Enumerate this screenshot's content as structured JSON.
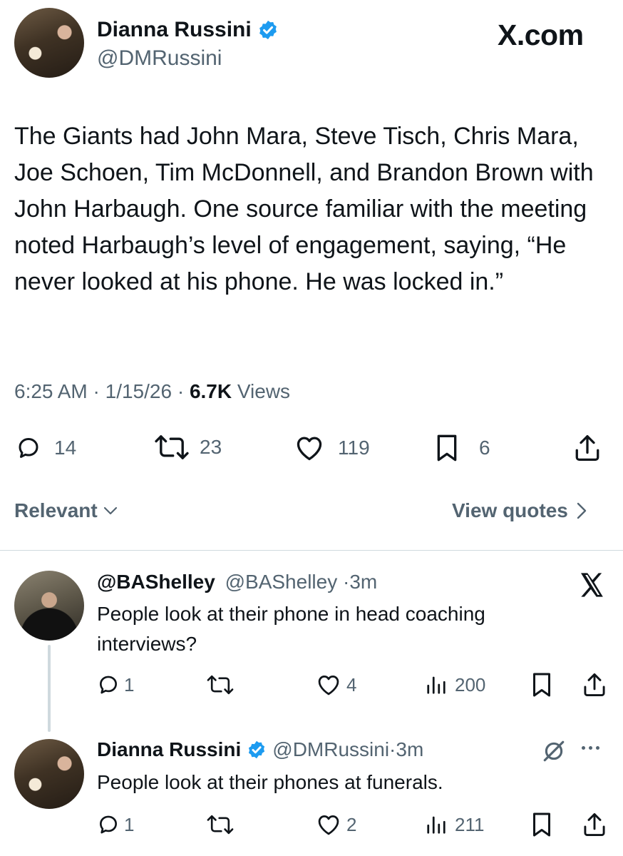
{
  "main_tweet": {
    "author_name": "Dianna Russini",
    "handle": "@DMRussini",
    "site": "X.com",
    "text": "The Giants had John Mara, Steve Tisch, Chris Mara, Joe Schoen, Tim McDonnell, and Brandon Brown with John Harbaugh. One source familiar with the meeting noted Harbaugh’s level of engagement, saying, “He never looked at his phone. He was locked in.”",
    "time": "6:25 AM",
    "date": "1/15/26",
    "views_count": "6.7K",
    "views_label": "Views",
    "replies": "14",
    "reposts": "23",
    "likes": "119",
    "bookmarks": "6"
  },
  "filters": {
    "sort_label": "Relevant",
    "view_quotes": "View quotes"
  },
  "reply1": {
    "author_name": "@BAShelley",
    "handle": "@BAShelley",
    "time": "3m",
    "text": "People look at their phone in head coaching interviews?",
    "replies": "1",
    "likes": "4",
    "views": "200"
  },
  "reply2": {
    "author_name": "Dianna Russini",
    "handle": "@DMRussini",
    "time": "3m",
    "text": "People look at their phones at funerals.",
    "replies": "1",
    "likes": "2",
    "views": "211"
  },
  "colors": {
    "text": "#0f1419",
    "muted": "#536471",
    "verified": "#1d9bf0",
    "divider": "#cfd9de"
  }
}
